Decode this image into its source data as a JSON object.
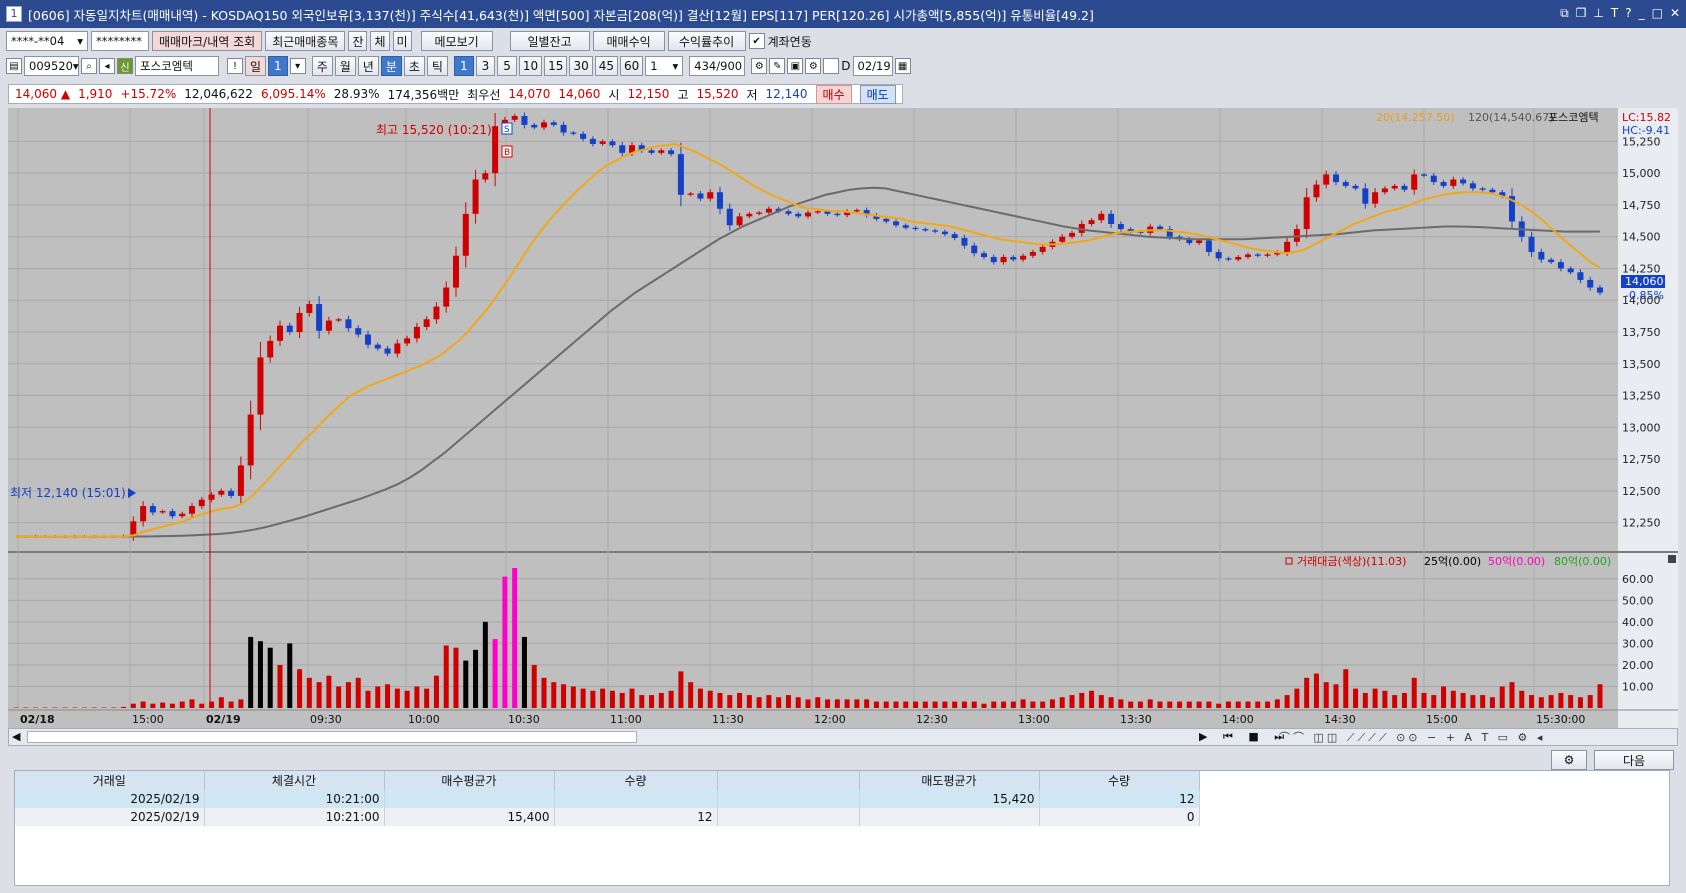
{
  "titlebar": {
    "num": "1",
    "title": "[0606] 자동일지차트(매매내역) - KOSDAQ150 외국인보유[3,137(천)] 주식수[41,643(천)] 액면[500] 자본금[208(억)] 결산[12월] EPS[117] PER[120.26] 시가총액[5,855(억)] 유통비율[49.2]"
  },
  "toolbar1": {
    "account": "****-**04",
    "password": "********",
    "btn_marks": "매매마크/내역 조회",
    "btn_recent": "최근매매종목",
    "btn_jan": "잔",
    "btn_che": "체",
    "btn_mi": "미",
    "btn_memo": "메모보기",
    "btn_daily": "일별잔고",
    "btn_profit": "매매수익",
    "btn_rate": "수익률추이",
    "chk_link": "계좌연동"
  },
  "toolbar2": {
    "code": "009520",
    "sin": "신",
    "name": "포스코엠텍",
    "btn_excl": "!",
    "period_day": "일",
    "period_day_val": "1",
    "weeks": [
      "주",
      "월",
      "년",
      "분",
      "초",
      "틱"
    ],
    "minutes": [
      "1",
      "3",
      "5",
      "10",
      "15",
      "30",
      "45",
      "60"
    ],
    "count_sel": "1",
    "count": "434",
    "total": "/900",
    "chk_d": "D",
    "date": "02/19"
  },
  "quote": {
    "price": "14,060",
    "change": "1,910",
    "rate": "+15.72%",
    "volume": "12,046,622",
    "vrate": "6,095.14%",
    "turn": "28.93%",
    "amount": "174,356백만",
    "best_label": "최우선",
    "best_ask": "14,070",
    "best_bid": "14,060",
    "open_label": "시",
    "open": "12,150",
    "high_label": "고",
    "high": "15,520",
    "low_label": "저",
    "low": "12,140",
    "buy_btn": "매수",
    "sell_btn": "매도"
  },
  "chart_data": [
    {
      "type": "line",
      "title": "",
      "price_axis": [
        "15,250",
        "15,000",
        "14,750",
        "14,500",
        "14,250",
        "14,000",
        "13,750",
        "13,500",
        "13,250",
        "13,000",
        "12,750",
        "12,500",
        "12,250"
      ],
      "ylim": [
        12050,
        15450
      ],
      "legend": {
        "ma20": "20(14,257.50)",
        "ma120": "120(14,540.67)",
        "name": "포스코엠텍",
        "lc": "LC:15.82",
        "hc": "HC:-9.41"
      },
      "high_mark": "최고 15,520 (10:21)",
      "low_mark": "최저 12,140 (15:01)",
      "last_price": "14,060",
      "last_rate": "-0.85%",
      "x_labels": [
        "02/18",
        "15:00",
        "02/19",
        "09:30",
        "10:00",
        "10:30",
        "11:00",
        "11:30",
        "12:00",
        "12:30",
        "13:00",
        "13:30",
        "14:00",
        "14:30",
        "15:00",
        "15:30:00"
      ],
      "close_series": [
        12140,
        12140,
        12142,
        12141,
        12140,
        12140,
        12142,
        12141,
        12140,
        12140,
        12140,
        12145,
        12260,
        12380,
        12330,
        12340,
        12300,
        12320,
        12380,
        12430,
        12470,
        12500,
        12460,
        12700,
        13100,
        13550,
        13680,
        13800,
        13750,
        13900,
        13970,
        13760,
        13840,
        13850,
        13780,
        13730,
        13650,
        13620,
        13580,
        13660,
        13700,
        13790,
        13850,
        13950,
        14100,
        14350,
        14680,
        14950,
        15000,
        15370,
        15420,
        15450,
        15380,
        15360,
        15400,
        15380,
        15320,
        15310,
        15270,
        15230,
        15250,
        15220,
        15160,
        15220,
        15180,
        15160,
        15180,
        15150,
        14830,
        14840,
        14800,
        14850,
        14720,
        14590,
        14660,
        14680,
        14690,
        14720,
        14700,
        14680,
        14660,
        14690,
        14700,
        14680,
        14670,
        14700,
        14710,
        14670,
        14640,
        14620,
        14590,
        14570,
        14560,
        14550,
        14540,
        14520,
        14490,
        14430,
        14370,
        14340,
        14300,
        14340,
        14320,
        14350,
        14380,
        14420,
        14460,
        14500,
        14530,
        14600,
        14630,
        14680,
        14600,
        14560,
        14540,
        14530,
        14580,
        14560,
        14500,
        14480,
        14450,
        14470,
        14380,
        14330,
        14320,
        14340,
        14360,
        14350,
        14360,
        14380,
        14460,
        14560,
        14810,
        14910,
        14990,
        14930,
        14900,
        14880,
        14760,
        14850,
        14880,
        14900,
        14870,
        14990,
        14980,
        14930,
        14900,
        14950,
        14920,
        14880,
        14870,
        14850,
        14820,
        14620,
        14500,
        14380,
        14320,
        14300,
        14250,
        14220,
        14160,
        14100,
        14060
      ],
      "ma20": [
        12140,
        12140,
        12140,
        12141,
        12141,
        12141,
        12141,
        12141,
        12141,
        12141,
        12141,
        12141,
        12150,
        12180,
        12200,
        12220,
        12240,
        12260,
        12290,
        12320,
        12340,
        12360,
        12370,
        12400,
        12460,
        12540,
        12620,
        12710,
        12790,
        12880,
        12950,
        13030,
        13110,
        13180,
        13250,
        13290,
        13330,
        13360,
        13390,
        13420,
        13450,
        13480,
        13520,
        13560,
        13620,
        13680,
        13760,
        13850,
        13940,
        14050,
        14160,
        14280,
        14400,
        14510,
        14610,
        14700,
        14780,
        14860,
        14930,
        15000,
        15060,
        15100,
        15140,
        15170,
        15190,
        15210,
        15220,
        15230,
        15200,
        15170,
        15130,
        15090,
        15050,
        15000,
        14950,
        14900,
        14860,
        14820,
        14790,
        14760,
        14730,
        14720,
        14710,
        14700,
        14700,
        14690,
        14680,
        14670,
        14660,
        14650,
        14640,
        14620,
        14610,
        14600,
        14590,
        14580,
        14560,
        14540,
        14520,
        14500,
        14480,
        14470,
        14460,
        14450,
        14440,
        14440,
        14440,
        14450,
        14460,
        14470,
        14490,
        14510,
        14530,
        14540,
        14540,
        14550,
        14550,
        14550,
        14540,
        14530,
        14520,
        14500,
        14480,
        14460,
        14440,
        14420,
        14400,
        14390,
        14380,
        14370,
        14380,
        14400,
        14440,
        14480,
        14520,
        14560,
        14600,
        14630,
        14660,
        14690,
        14710,
        14730,
        14760,
        14790,
        14810,
        14830,
        14840,
        14850,
        14850,
        14850,
        14840,
        14820,
        14790,
        14750,
        14700,
        14640,
        14570,
        14500,
        14430,
        14370,
        14300,
        14257
      ],
      "ma120": [
        12140,
        12140,
        12140,
        12140,
        12140,
        12140,
        12140,
        12140,
        12140,
        12140,
        12141,
        12141,
        12142,
        12144,
        12146,
        12150,
        12155,
        12160,
        12168,
        12180,
        12195,
        12215,
        12240,
        12265,
        12290,
        12320,
        12350,
        12380,
        12410,
        12440,
        12475,
        12510,
        12550,
        12600,
        12660,
        12730,
        12800,
        12880,
        12960,
        13040,
        13120,
        13200,
        13280,
        13360,
        13440,
        13520,
        13600,
        13680,
        13760,
        13840,
        13920,
        13990,
        14060,
        14120,
        14180,
        14240,
        14300,
        14360,
        14420,
        14480,
        14530,
        14580,
        14620,
        14660,
        14700,
        14740,
        14770,
        14800,
        14830,
        14850,
        14870,
        14880,
        14885,
        14880,
        14860,
        14840,
        14820,
        14800,
        14780,
        14760,
        14740,
        14720,
        14700,
        14680,
        14660,
        14640,
        14620,
        14600,
        14580,
        14565,
        14550,
        14540,
        14530,
        14520,
        14510,
        14500,
        14495,
        14490,
        14485,
        14480,
        14480,
        14480,
        14480,
        14480,
        14485,
        14490,
        14495,
        14500,
        14505,
        14510,
        14515,
        14520,
        14530,
        14540,
        14550,
        14555,
        14560,
        14565,
        14570,
        14575,
        14580,
        14580,
        14578,
        14575,
        14570,
        14565,
        14560,
        14555,
        14550,
        14545,
        14540,
        14540,
        14540,
        14541
      ]
    },
    {
      "type": "bar",
      "title": "",
      "legend": {
        "name": "거래대금(색상)(11.03)",
        "a": "25억(0.00)",
        "b": "50억(0.00)",
        "c": "80억(0.00)"
      },
      "ylim": [
        0,
        65
      ],
      "y_ticks": [
        "60.00",
        "50.00",
        "40.00",
        "30.00",
        "20.00",
        "10.00"
      ],
      "values": [
        0.2,
        0.2,
        0.2,
        0.2,
        0.2,
        0.2,
        0.2,
        0.2,
        0.2,
        0.2,
        0.2,
        0.5,
        2,
        3,
        2,
        2.5,
        2,
        3,
        4,
        2,
        3,
        5,
        3,
        4,
        33,
        31,
        28,
        20,
        30,
        18,
        14,
        12,
        15,
        10,
        12,
        14,
        8,
        10,
        11,
        9,
        8,
        10,
        9,
        15,
        29,
        28,
        22,
        27,
        40,
        32,
        61,
        65,
        33,
        20,
        14,
        12,
        11,
        10,
        9,
        8,
        9,
        8,
        7,
        9,
        6,
        6,
        7,
        8,
        17,
        12,
        9,
        8,
        7,
        6,
        7,
        6,
        5,
        6,
        5,
        6,
        5,
        4,
        5,
        4,
        4,
        4,
        4,
        4,
        3,
        3,
        3,
        3,
        3,
        3,
        3,
        3,
        3,
        3,
        3,
        2,
        3,
        3,
        3,
        4,
        3,
        3,
        4,
        5,
        6,
        7,
        8,
        6,
        5,
        4,
        3,
        3,
        4,
        3,
        3,
        3,
        3,
        3,
        3,
        2,
        3,
        3,
        3,
        3,
        3,
        4,
        6,
        9,
        14,
        16,
        12,
        11,
        18,
        9,
        7,
        9,
        8,
        6,
        7,
        14,
        7,
        6,
        10,
        8,
        7,
        6,
        6,
        5,
        10,
        12,
        8,
        6,
        5,
        6,
        7,
        6,
        5,
        6,
        11
      ],
      "colors": [
        "#d00000",
        "#000000",
        "#ff00c8"
      ],
      "black_idx": [
        24,
        25,
        26,
        28,
        46,
        47,
        48,
        50,
        52
      ],
      "pink_idx": [
        49,
        50,
        51
      ]
    }
  ],
  "table": {
    "headers": [
      "거래일",
      "체결시간",
      "매수평균가",
      "수량",
      "",
      "매도평균가",
      "수량"
    ],
    "rows": [
      [
        "2025/02/19",
        "10:21:00",
        "",
        "",
        "",
        "15,420",
        "12"
      ],
      [
        "2025/02/19",
        "10:21:00",
        "15,400",
        "12",
        "",
        "",
        "0"
      ]
    ]
  },
  "bottom": {
    "next_btn": "다음"
  }
}
